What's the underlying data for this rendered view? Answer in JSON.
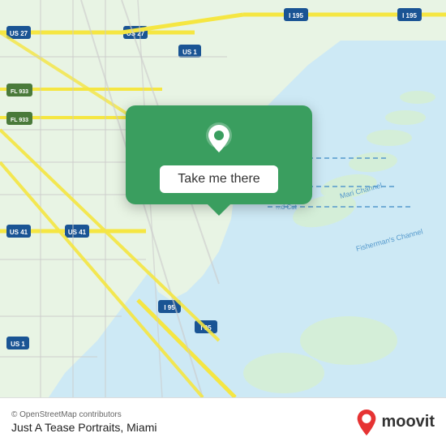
{
  "map": {
    "attribution": "© OpenStreetMap contributors",
    "background_color": "#dbe9db"
  },
  "action_card": {
    "button_label": "Take me there",
    "pin_color": "#ffffff"
  },
  "bottom_bar": {
    "osm_credit": "© OpenStreetMap contributors",
    "location_name": "Just A Tease Portraits, Miami",
    "moovit_label": "moovit"
  }
}
